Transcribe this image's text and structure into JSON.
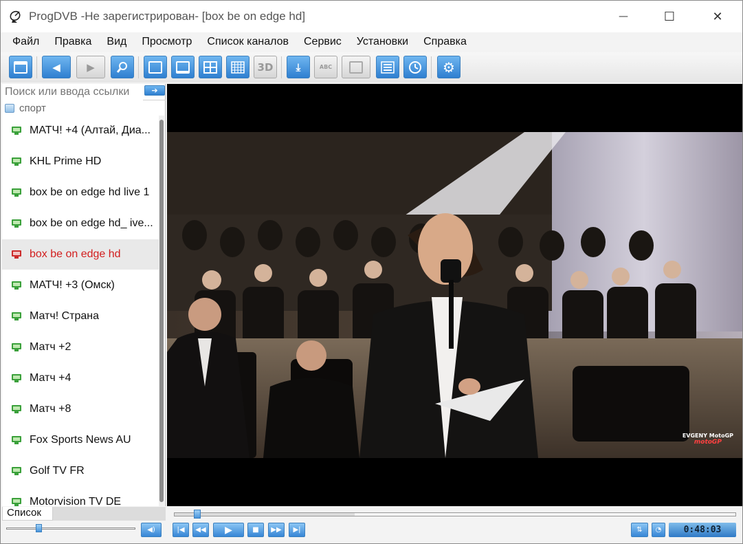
{
  "window": {
    "title": "ProgDVB -Не зарегистрирован-  [box be on edge hd]",
    "minimize": "—",
    "maximize": "☐",
    "close": "✕"
  },
  "menu": [
    "Файл",
    "Правка",
    "Вид",
    "Просмотр",
    "Список каналов",
    "Сервис",
    "Установки",
    "Справка"
  ],
  "toolbar": {
    "button_3d": "3D",
    "button_abc": "ABC"
  },
  "sidebar": {
    "search_placeholder": "Поиск или ввода ссылки",
    "group": "спорт",
    "channels": [
      {
        "label": "МАТЧ! +4 (Алтай, Диа..."
      },
      {
        "label": "KHL Prime HD"
      },
      {
        "label": "box be on edge hd live 1"
      },
      {
        "label": "box be on edge hd_ ive..."
      },
      {
        "label": "box be on edge hd",
        "selected": true
      },
      {
        "label": "МАТЧ! +3 (Омск)"
      },
      {
        "label": "Матч! Страна"
      },
      {
        "label": "Матч +2"
      },
      {
        "label": "Матч +4"
      },
      {
        "label": "Матч +8"
      },
      {
        "label": "Fox Sports News AU"
      },
      {
        "label": "Golf TV FR"
      },
      {
        "label": "Motorvision TV DE"
      }
    ],
    "tab": "Список",
    "volume_level": 0.25
  },
  "video": {
    "watermark_line1": "EVGENY MotoGP",
    "watermark_line2": "motoGP"
  },
  "player": {
    "position_fraction": 0.035,
    "buffer_fraction": 0.32,
    "time": "0:48:03"
  }
}
